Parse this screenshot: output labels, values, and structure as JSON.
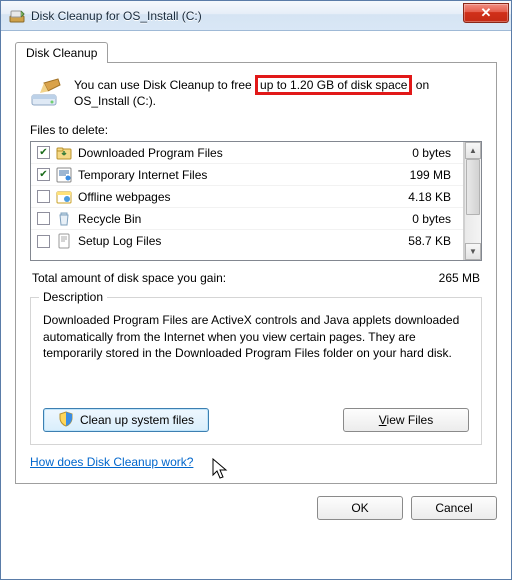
{
  "window": {
    "title": "Disk Cleanup for OS_Install (C:)"
  },
  "tab": {
    "label": "Disk Cleanup"
  },
  "intro": {
    "before": "You can use Disk Cleanup to free ",
    "highlight": "up to 1.20 GB of disk space",
    "after": " on OS_Install (C:)."
  },
  "list": {
    "label": "Files to delete:",
    "rows": [
      {
        "checked": true,
        "icon": "folder-download",
        "name": "Downloaded Program Files",
        "size": "0 bytes"
      },
      {
        "checked": true,
        "icon": "ie-cache",
        "name": "Temporary Internet Files",
        "size": "199 MB"
      },
      {
        "checked": false,
        "icon": "offline-pages",
        "name": "Offline webpages",
        "size": "4.18 KB"
      },
      {
        "checked": false,
        "icon": "recycle-bin",
        "name": "Recycle Bin",
        "size": "0 bytes"
      },
      {
        "checked": false,
        "icon": "setup-log",
        "name": "Setup Log Files",
        "size": "58.7 KB"
      }
    ]
  },
  "total": {
    "label": "Total amount of disk space you gain:",
    "value": "265 MB"
  },
  "description": {
    "legend": "Description",
    "text": "Downloaded Program Files are ActiveX controls and Java applets downloaded automatically from the Internet when you view certain pages. They are temporarily stored in the Downloaded Program Files folder on your hard disk."
  },
  "buttons": {
    "cleanup_system": "Clean up system files",
    "view_files": "View Files",
    "ok": "OK",
    "cancel": "Cancel"
  },
  "help_link": "How does Disk Cleanup work?"
}
